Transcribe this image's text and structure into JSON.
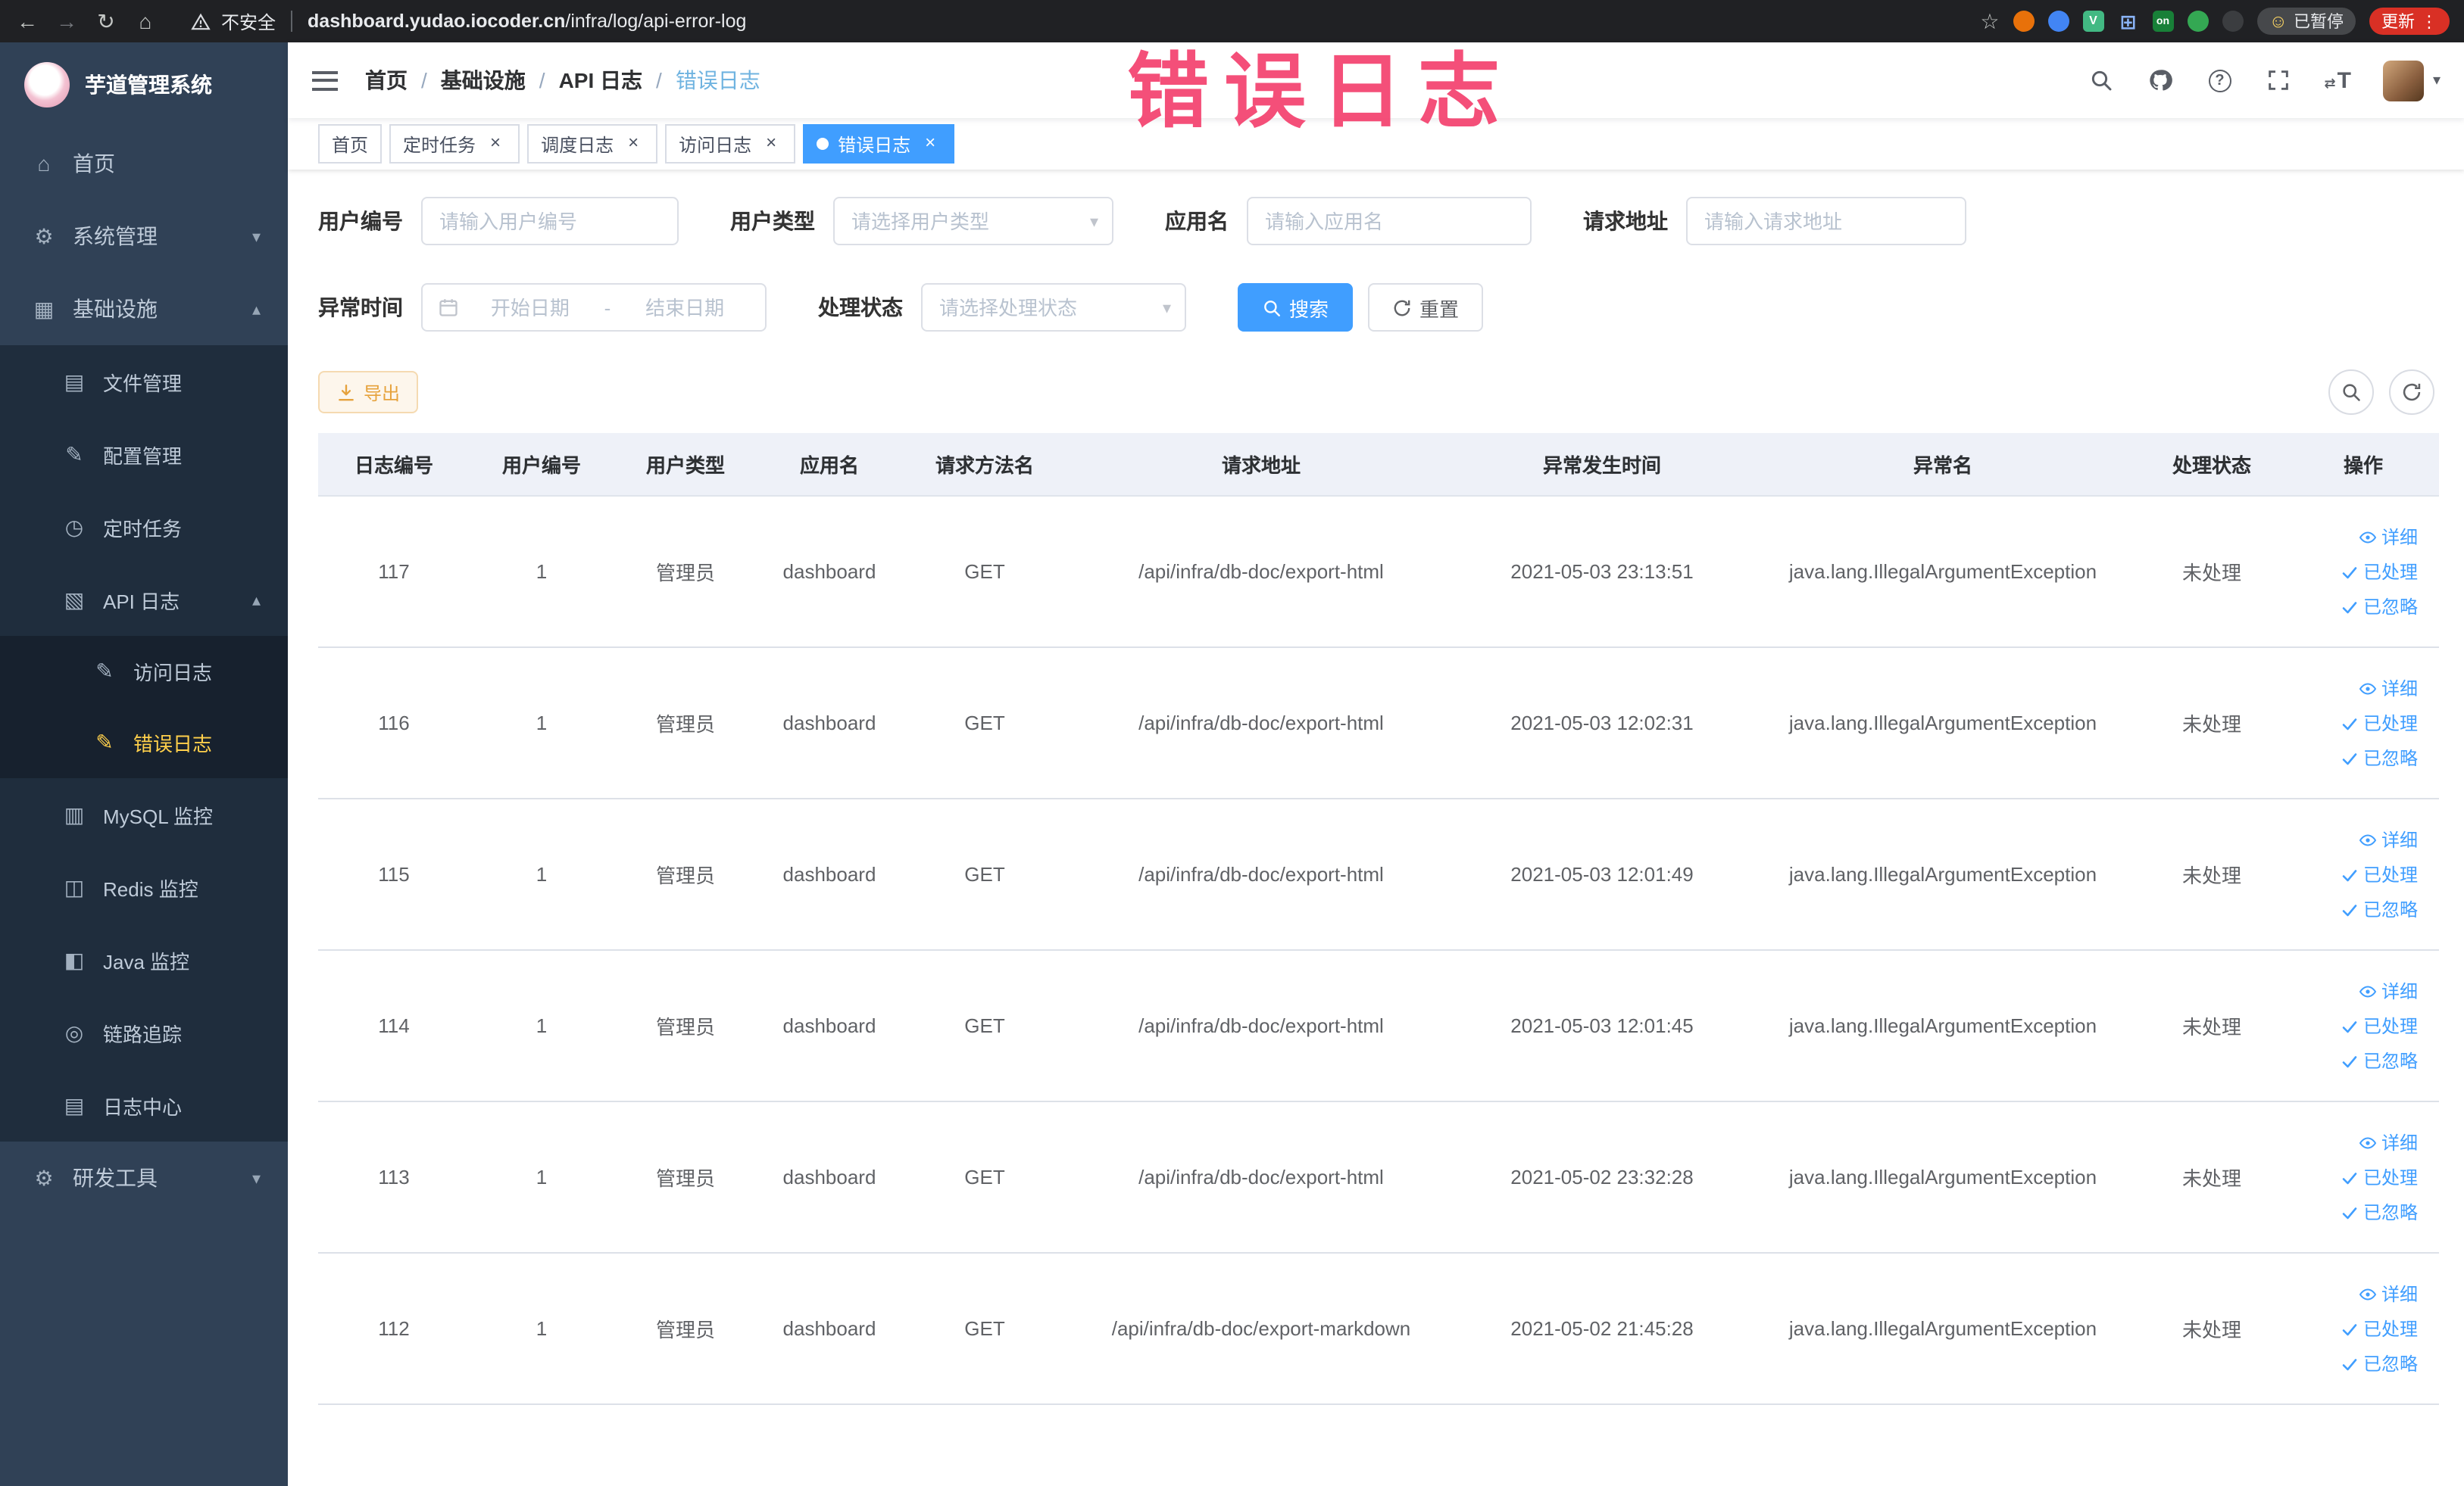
{
  "browser": {
    "security_label": "不安全",
    "url_domain": "dashboard.yudao.iocoder.cn",
    "url_path": "/infra/log/api-error-log",
    "paused_label": "已暂停",
    "update_label": "更新",
    "vue_badge": "V",
    "on_badge": "on"
  },
  "annotation": {
    "text": "错误日志"
  },
  "icons": {
    "back": "←",
    "forward": "→",
    "reload": "↻",
    "home": "⌂",
    "star": "☆",
    "kebab": "⋮",
    "caret_down": "▾",
    "caret_up": "▴",
    "close": "×",
    "smiley": "☺",
    "size_arrows": "⇄",
    "help": "?",
    "grid_squares": "⊞",
    "menu_home": "⌂",
    "menu_gear": "⚙",
    "menu_infra": "▦",
    "menu_folder": "▤",
    "menu_edit": "✎",
    "menu_clock": "◷",
    "menu_apilog": "▧",
    "menu_doc": "✎",
    "menu_mysql": "▥",
    "menu_redis": "◫",
    "menu_java": "◧",
    "menu_trace": "◎",
    "menu_logcenter": "▤",
    "menu_tools": "⚙"
  },
  "sidebar": {
    "title": "芋道管理系统",
    "items": [
      {
        "label": "首页"
      },
      {
        "label": "系统管理"
      },
      {
        "label": "基础设施"
      },
      {
        "label": "文件管理"
      },
      {
        "label": "配置管理"
      },
      {
        "label": "定时任务"
      },
      {
        "label": "API 日志"
      },
      {
        "label": "访问日志"
      },
      {
        "label": "错误日志"
      },
      {
        "label": "MySQL 监控"
      },
      {
        "label": "Redis 监控"
      },
      {
        "label": "Java 监控"
      },
      {
        "label": "链路追踪"
      },
      {
        "label": "日志中心"
      },
      {
        "label": "研发工具"
      }
    ]
  },
  "breadcrumb": [
    "首页",
    "基础设施",
    "API 日志",
    "错误日志"
  ],
  "tabs": [
    {
      "label": "首页"
    },
    {
      "label": "定时任务"
    },
    {
      "label": "调度日志"
    },
    {
      "label": "访问日志"
    },
    {
      "label": "错误日志"
    }
  ],
  "filters": {
    "user_id_label": "用户编号",
    "user_id_placeholder": "请输入用户编号",
    "user_type_label": "用户类型",
    "user_type_placeholder": "请选择用户类型",
    "app_name_label": "应用名",
    "app_name_placeholder": "请输入应用名",
    "request_url_label": "请求地址",
    "request_url_placeholder": "请输入请求地址",
    "time_label": "异常时间",
    "time_start_placeholder": "开始日期",
    "time_separator": "-",
    "time_end_placeholder": "结束日期",
    "status_label": "处理状态",
    "status_placeholder": "请选择处理状态",
    "search_label": "搜索",
    "reset_label": "重置"
  },
  "toolbar": {
    "export_label": "导出"
  },
  "table": {
    "headers": [
      "日志编号",
      "用户编号",
      "用户类型",
      "应用名",
      "请求方法名",
      "请求地址",
      "异常发生时间",
      "异常名",
      "处理状态",
      "操作"
    ],
    "action_labels": [
      "详细",
      "已处理",
      "已忽略"
    ],
    "rows": [
      {
        "log_id": "117",
        "user_id": "1",
        "user_type": "管理员",
        "app_name": "dashboard",
        "method": "GET",
        "request_url": "/api/infra/db-doc/export-html",
        "time": "2021-05-03 23:13:51",
        "exception": "java.lang.IllegalArgumentException",
        "status": "未处理"
      },
      {
        "log_id": "116",
        "user_id": "1",
        "user_type": "管理员",
        "app_name": "dashboard",
        "method": "GET",
        "request_url": "/api/infra/db-doc/export-html",
        "time": "2021-05-03 12:02:31",
        "exception": "java.lang.IllegalArgumentException",
        "status": "未处理"
      },
      {
        "log_id": "115",
        "user_id": "1",
        "user_type": "管理员",
        "app_name": "dashboard",
        "method": "GET",
        "request_url": "/api/infra/db-doc/export-html",
        "time": "2021-05-03 12:01:49",
        "exception": "java.lang.IllegalArgumentException",
        "status": "未处理"
      },
      {
        "log_id": "114",
        "user_id": "1",
        "user_type": "管理员",
        "app_name": "dashboard",
        "method": "GET",
        "request_url": "/api/infra/db-doc/export-html",
        "time": "2021-05-03 12:01:45",
        "exception": "java.lang.IllegalArgumentException",
        "status": "未处理"
      },
      {
        "log_id": "113",
        "user_id": "1",
        "user_type": "管理员",
        "app_name": "dashboard",
        "method": "GET",
        "request_url": "/api/infra/db-doc/export-html",
        "time": "2021-05-02 23:32:28",
        "exception": "java.lang.IllegalArgumentException",
        "status": "未处理"
      },
      {
        "log_id": "112",
        "user_id": "1",
        "user_type": "管理员",
        "app_name": "dashboard",
        "method": "GET",
        "request_url": "/api/infra/db-doc/export-markdown",
        "time": "2021-05-02 21:45:28",
        "exception": "java.lang.IllegalArgumentException",
        "status": "未处理"
      }
    ]
  }
}
